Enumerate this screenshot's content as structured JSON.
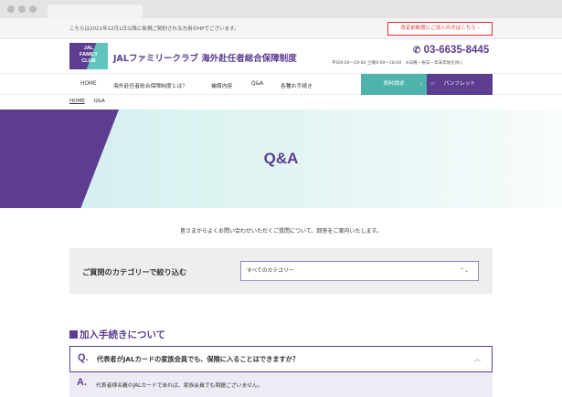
{
  "notice": {
    "text": "こちらは2021年12月1日以降に新規ご契約される方用のHPでございます。",
    "button_label": "改定前制度にご加入の方はこちら ›"
  },
  "header": {
    "logo_lines": [
      "JAL",
      "FAMILY",
      "CLUB"
    ],
    "site_title": "JALファミリークラブ 海外赴任者総合保障制度",
    "phone": "03-6635-8445",
    "phone_icon": "phone-icon",
    "hours": "平日9:00〜19:00 土曜9:00〜18:00　※日曜・祝日・年末年始を除く"
  },
  "nav": {
    "items": [
      "HOME",
      "海外赴任者総合保障制度とは？",
      "補償内容",
      "Q&A",
      "各種お手続き"
    ],
    "docs_button": "資料請求",
    "pamphlet_button": "パンフレット"
  },
  "breadcrumb": {
    "home": "HOME",
    "current": "Q&A"
  },
  "hero": {
    "title": "Q&A"
  },
  "intro": "皆さまからよくお問い合わせいただくご質問について、回答をご案内いたします。",
  "filter": {
    "label": "ご質問のカテゴリーで絞り込む",
    "selected": "すべてのカテゴリー"
  },
  "section": {
    "title": "加入手続きについて",
    "question_mark": "Q.",
    "question": "代表者がJALカードの家族会員でも、保険に入ることはできますか？",
    "answer_mark": "A.",
    "answer": "代表者様名義のJALカードであれば、家族会員でも問題ございません。"
  },
  "colors": {
    "brand_purple": "#5c3d8f",
    "teal": "#4fb3ac",
    "notice_red": "#d33333"
  }
}
